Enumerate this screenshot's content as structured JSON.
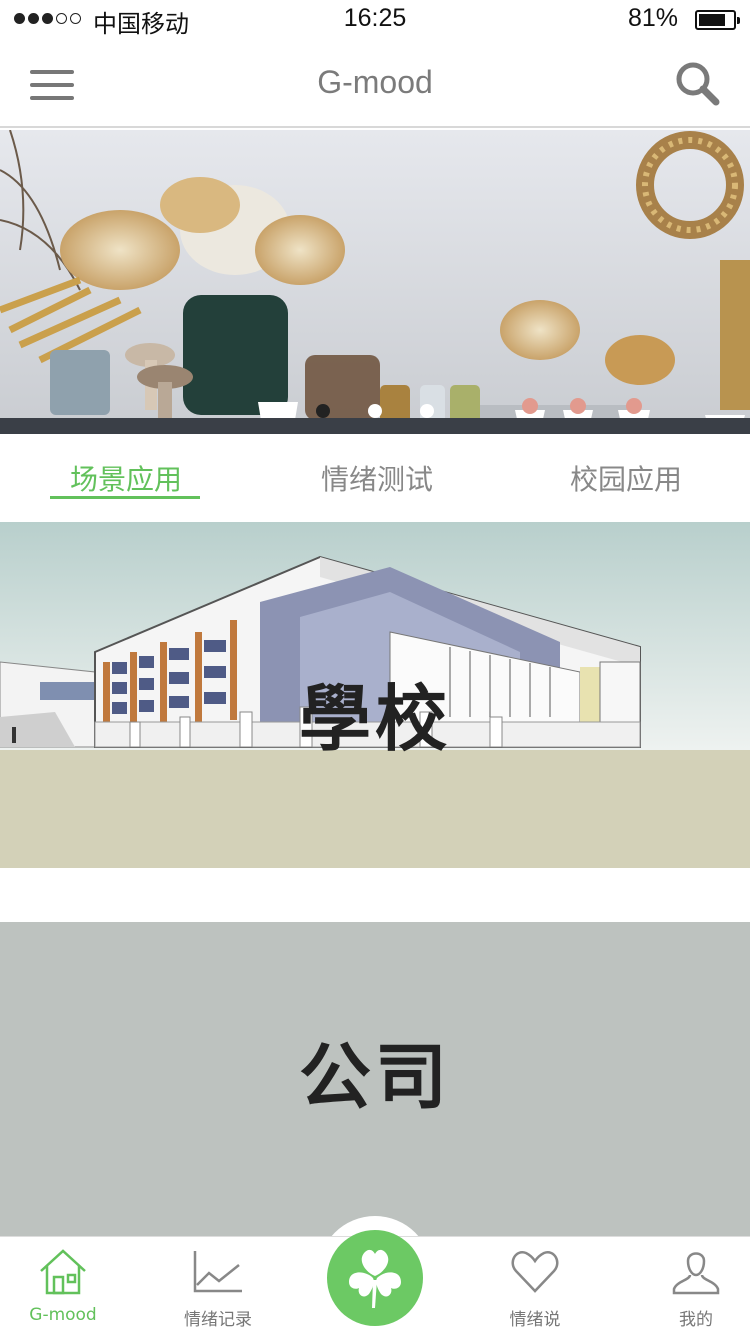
{
  "status_bar": {
    "carrier": "中国移动",
    "time": "16:25",
    "battery": "81%",
    "battery_level": 0.81,
    "signal_bars": 3
  },
  "nav": {
    "title": "G-mood",
    "menu_icon": "menu-icon",
    "search_icon": "search-icon"
  },
  "banner": {
    "slide_count": 3,
    "active_index": 0
  },
  "tabs": [
    {
      "label": "场景应用",
      "active": true
    },
    {
      "label": "情绪测试",
      "active": false
    },
    {
      "label": "校园应用",
      "active": false
    }
  ],
  "cards": {
    "school": "學校",
    "company": "公司"
  },
  "tabbar": {
    "items": [
      {
        "label": "G-mood",
        "icon": "house-icon",
        "active": true
      },
      {
        "label": "情绪记录",
        "icon": "line-chart-icon",
        "active": false
      },
      {
        "label": "",
        "icon": "clover-icon",
        "active": false
      },
      {
        "label": "情绪说",
        "icon": "heart-icon",
        "active": false
      },
      {
        "label": "我的",
        "icon": "user-icon",
        "active": false
      }
    ]
  },
  "colors": {
    "accent": "#62c15b",
    "center_button": "#6cc964",
    "company_card": "#bdc2bf"
  }
}
